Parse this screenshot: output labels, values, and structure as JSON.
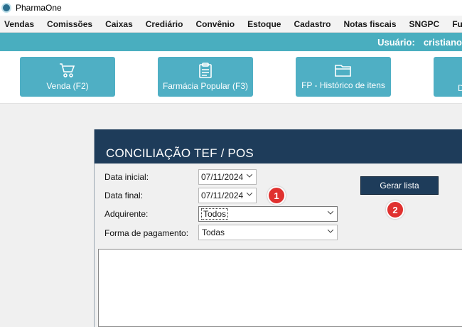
{
  "window": {
    "title": "PharmaOne"
  },
  "menu": [
    "Vendas",
    "Comissões",
    "Caixas",
    "Crediário",
    "Convênio",
    "Estoque",
    "Cadastro",
    "Notas fiscais",
    "SNGPC",
    "Funções a"
  ],
  "user": {
    "label": "Usuário:",
    "name": "cristiano"
  },
  "toolbar": {
    "venda": "Venda (F2)",
    "farmacia_popular": "Farmácia Popular (F3)",
    "fp_historico": "FP - Histórico de itens",
    "fourth": "D"
  },
  "panel": {
    "title": "CONCILIAÇÃO TEF / POS",
    "data_inicial_label": "Data inicial:",
    "data_inicial_value": "07/11/2024",
    "data_final_label": "Data final:",
    "data_final_value": "07/11/2024",
    "adquirente_label": "Adquirente:",
    "adquirente_value": "Todos",
    "forma_label": "Forma de pagamento:",
    "forma_value": "Todas",
    "gerar_label": "Gerar lista",
    "badge1": "1",
    "badge2": "2"
  },
  "colors": {
    "accent": "#49aebf",
    "toolbar_button": "#4fafc4",
    "panel_header": "#1e3c5a",
    "badge": "#e0312f"
  }
}
